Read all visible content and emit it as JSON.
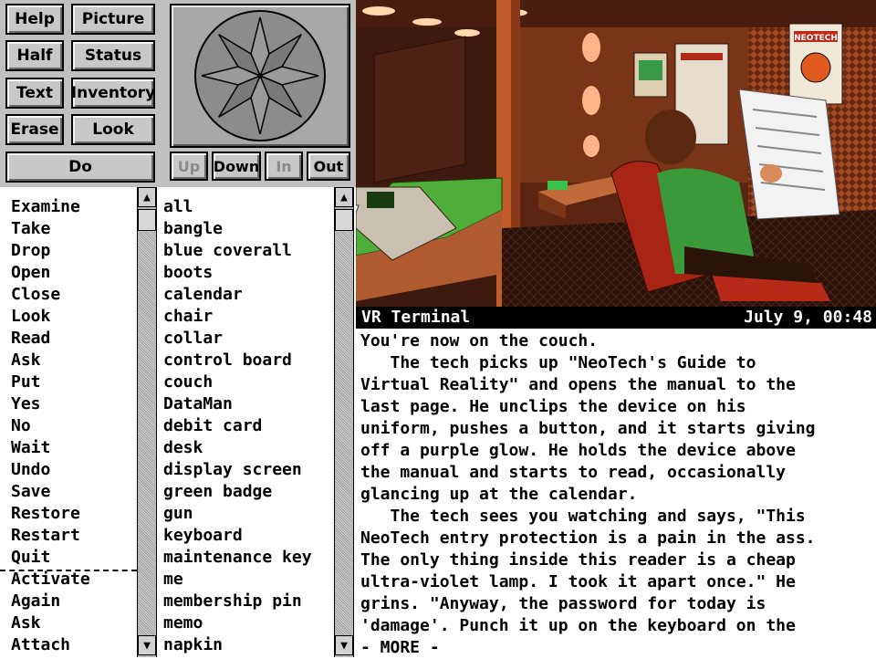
{
  "controls": {
    "help": "Help",
    "picture": "Picture",
    "half": "Half",
    "status": "Status",
    "text": "Text",
    "inventory": "Inventory",
    "erase": "Erase",
    "look": "Look",
    "do": "Do",
    "up": "Up",
    "down": "Down",
    "in": "In",
    "out": "Out"
  },
  "status_bar": {
    "room": "VR Terminal",
    "date": "July 9, 00:48"
  },
  "scene": {
    "poster_text": "NEOTECH"
  },
  "verbs": [
    "Examine",
    "Take",
    "Drop",
    "Open",
    "Close",
    "Look",
    "Read",
    "Ask",
    "Put",
    "Yes",
    "No",
    "Wait",
    "Undo",
    "Save",
    "Restore",
    "Restart",
    "Quit",
    "Activate",
    "Again",
    "Ask",
    "Attach"
  ],
  "nouns": [
    "all",
    "bangle",
    "blue coverall",
    "boots",
    "calendar",
    "chair",
    "collar",
    "control board",
    "couch",
    "DataMan",
    "debit card",
    "desk",
    "display screen",
    "green badge",
    "gun",
    "keyboard",
    "maintenance key",
    "me",
    "membership pin",
    "memo",
    "napkin"
  ],
  "narrative": [
    "You're now on the couch.",
    "   The tech picks up \"NeoTech's Guide to",
    "Virtual Reality\" and opens the manual to the",
    "last page. He unclips the device on his",
    "uniform, pushes a button, and it starts giving",
    "off a purple glow. He holds the device above",
    "the manual and starts to read, occasionally",
    "glancing up at the calendar.",
    "   The tech sees you watching and says, \"This",
    "NeoTech entry protection is a pain in the ass.",
    "The only thing inside this reader is a cheap",
    "ultra-violet lamp. I took it apart once.\" He",
    "grins. \"Anyway, the password for today is",
    "'damage'. Punch it up on the keyboard on the",
    "- MORE -"
  ],
  "colors": {
    "panel": "#c0c0c0",
    "scene_wall": "#5a2612",
    "bed_green": "#4fae3a"
  }
}
